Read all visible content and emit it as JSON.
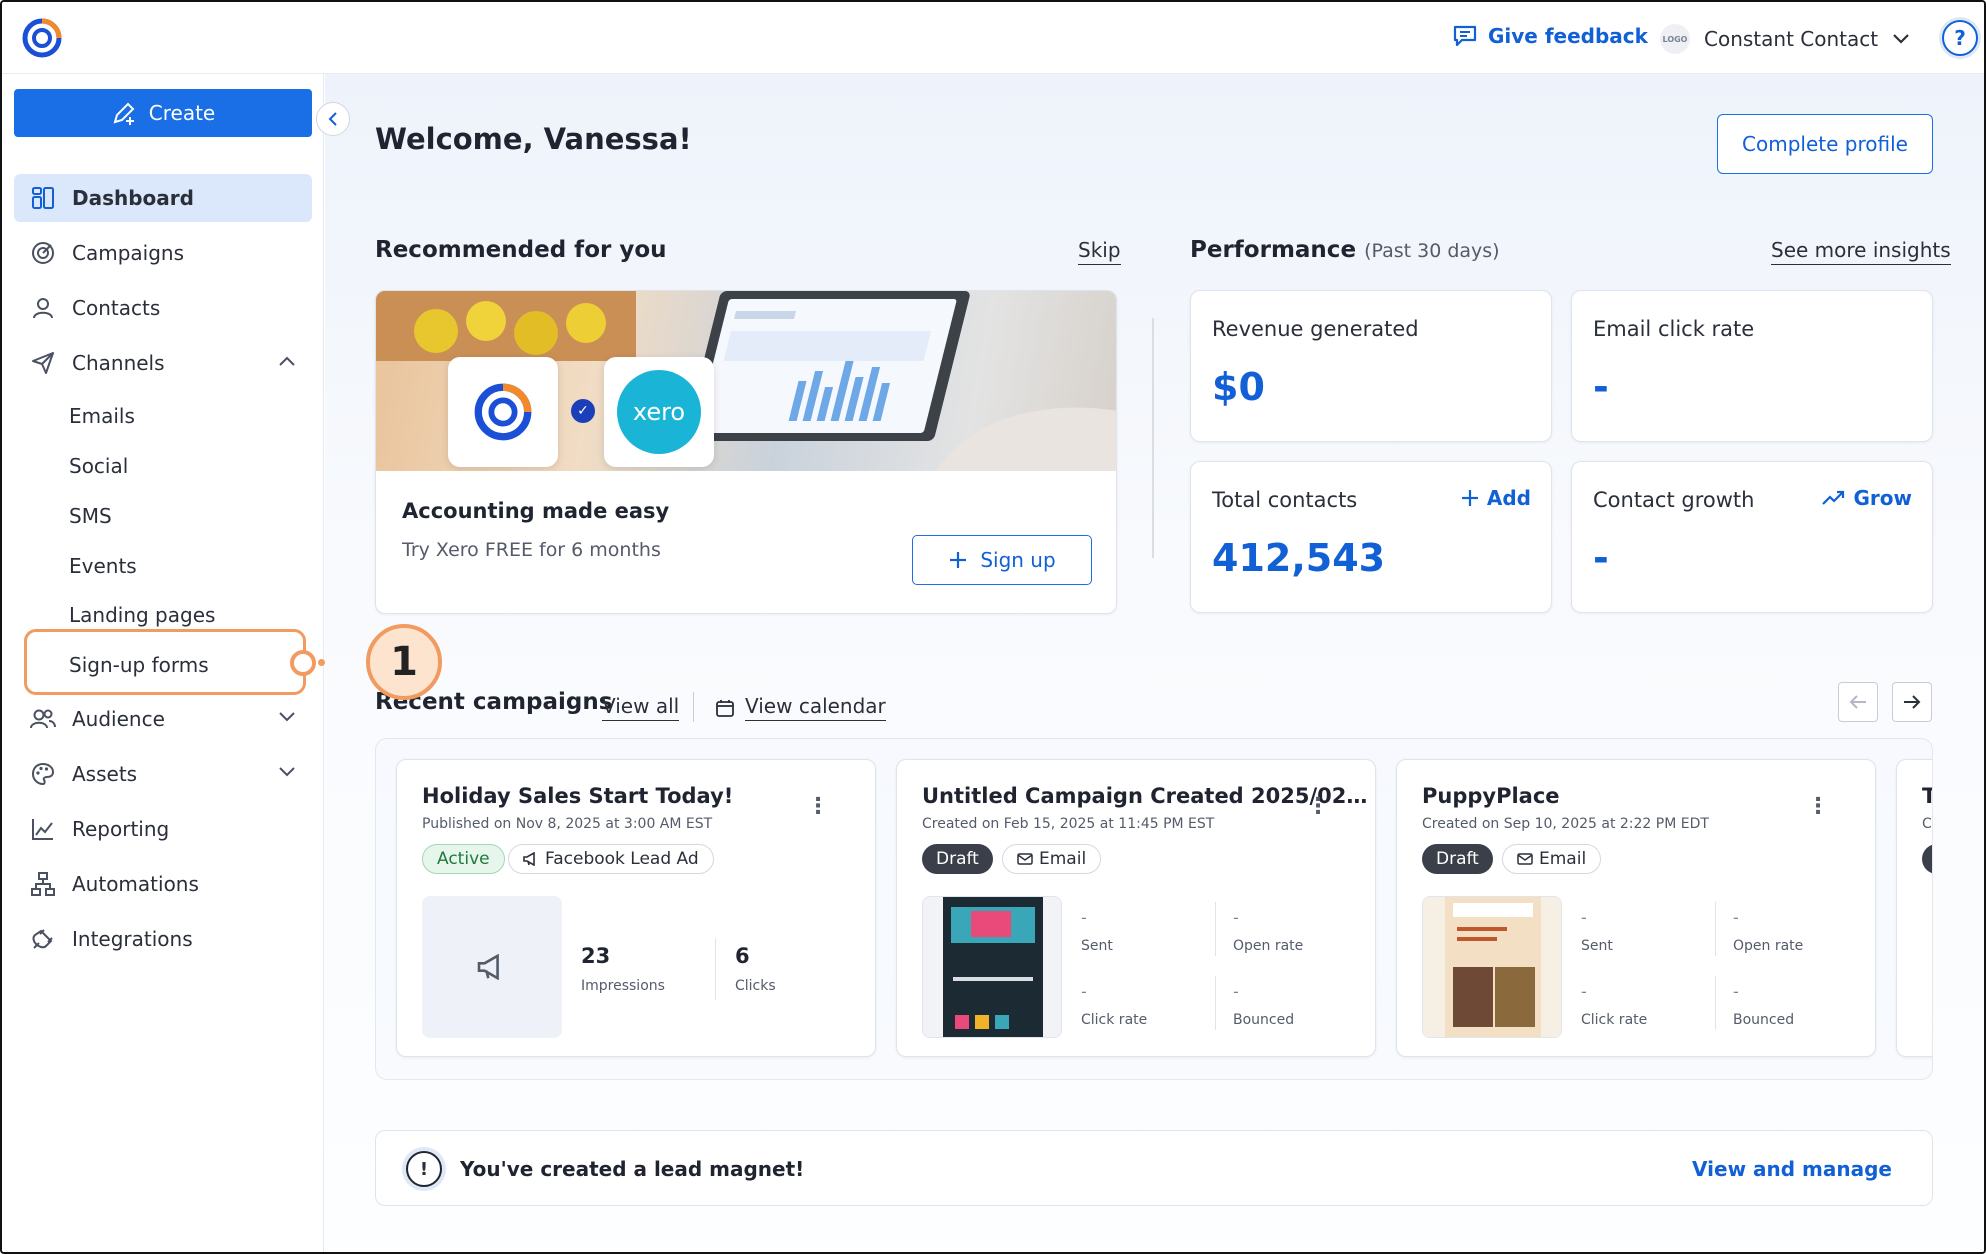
{
  "topbar": {
    "feedback_label": "Give feedback",
    "logo_badge": "LOGO",
    "account_name": "Constant Contact",
    "help_glyph": "?"
  },
  "sidebar": {
    "create_label": "Create",
    "items": [
      {
        "label": "Dashboard",
        "icon": "dashboard-icon"
      },
      {
        "label": "Campaigns",
        "icon": "campaigns-icon"
      },
      {
        "label": "Contacts",
        "icon": "contacts-icon"
      },
      {
        "label": "Channels",
        "icon": "paper-plane-icon"
      },
      {
        "label": "Audience",
        "icon": "audience-icon"
      },
      {
        "label": "Assets",
        "icon": "palette-icon"
      },
      {
        "label": "Reporting",
        "icon": "chart-icon"
      },
      {
        "label": "Automations",
        "icon": "automations-icon"
      },
      {
        "label": "Integrations",
        "icon": "plug-icon"
      }
    ],
    "channels": [
      "Emails",
      "Social",
      "SMS",
      "Events",
      "Landing pages",
      "Sign-up forms"
    ],
    "callout_number": "1"
  },
  "main": {
    "welcome": "Welcome, Vanessa!",
    "complete_profile": "Complete profile",
    "recommended": {
      "title": "Recommended for you",
      "skip": "Skip",
      "card_title": "Accounting made easy",
      "card_sub": "Try Xero FREE for 6 months",
      "xero_label": "xero",
      "signup": "Sign up"
    },
    "performance": {
      "title": "Performance",
      "period": "(Past 30 days)",
      "see_more": "See more insights",
      "tiles": [
        {
          "label": "Revenue generated",
          "value": "$0",
          "action": ""
        },
        {
          "label": "Email click rate",
          "value": "-",
          "action": ""
        },
        {
          "label": "Total contacts",
          "value": "412,543",
          "action": "Add"
        },
        {
          "label": "Contact growth",
          "value": "-",
          "action": "Grow"
        }
      ]
    },
    "recent": {
      "title": "Recent campaigns",
      "view_all": "View all",
      "view_calendar": "View calendar",
      "campaigns": [
        {
          "title": "Holiday Sales Start Today!",
          "meta": "Published on Nov 8, 2025 at 3:00 AM EST",
          "status": "Active",
          "type": "Facebook Lead Ad",
          "impressions": "23",
          "impressions_label": "Impressions",
          "clicks": "6",
          "clicks_label": "Clicks"
        },
        {
          "title": "Untitled Campaign Created 2025/02…",
          "meta": "Created on Feb 15, 2025 at 11:45 PM EST",
          "status": "Draft",
          "type": "Email",
          "stats": [
            {
              "value": "-",
              "label": "Sent"
            },
            {
              "value": "-",
              "label": "Open rate"
            },
            {
              "value": "-",
              "label": "Click rate"
            },
            {
              "value": "-",
              "label": "Bounced"
            }
          ]
        },
        {
          "title": "PuppyPlace",
          "meta": "Created on Sep 10, 2025 at 2:22 PM EDT",
          "status": "Draft",
          "type": "Email",
          "stats": [
            {
              "value": "-",
              "label": "Sent"
            },
            {
              "value": "-",
              "label": "Open rate"
            },
            {
              "value": "-",
              "label": "Click rate"
            },
            {
              "value": "-",
              "label": "Bounced"
            }
          ]
        }
      ],
      "partial_title": "T",
      "partial_meta": "C"
    },
    "lead": {
      "text": "You've created a lead magnet!",
      "link": "View and manage"
    }
  }
}
